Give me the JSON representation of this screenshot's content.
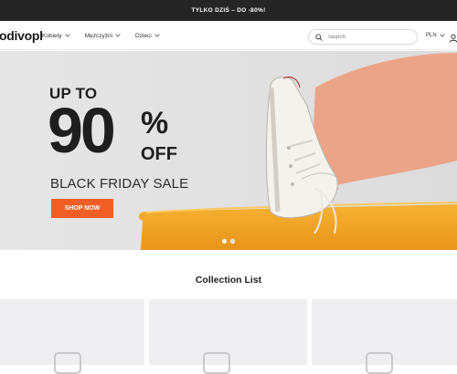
{
  "announcement": "TYLKO DZIŚ – DO -80%!",
  "header": {
    "logo": "odivopl",
    "nav": [
      {
        "label": "Kobiety"
      },
      {
        "label": "Mężczyźni"
      },
      {
        "label": "Dzieci"
      }
    ],
    "search_placeholder": "Search",
    "currency": "PLN"
  },
  "hero": {
    "pre": "UP TO",
    "big": "90",
    "pct": "%",
    "off": "OFF",
    "subtitle": "BLACK FRIDAY SALE",
    "button": "SHOP NOW",
    "slide_count": 2,
    "active_slide": 1
  },
  "collection": {
    "title": "Collection List",
    "cards": 3
  },
  "colors": {
    "accent": "#f05e23",
    "topbar": "#252525",
    "hero_bg": "#e3e3e3",
    "cushion": "#f2a51e",
    "card_bg": "#efeff1"
  }
}
